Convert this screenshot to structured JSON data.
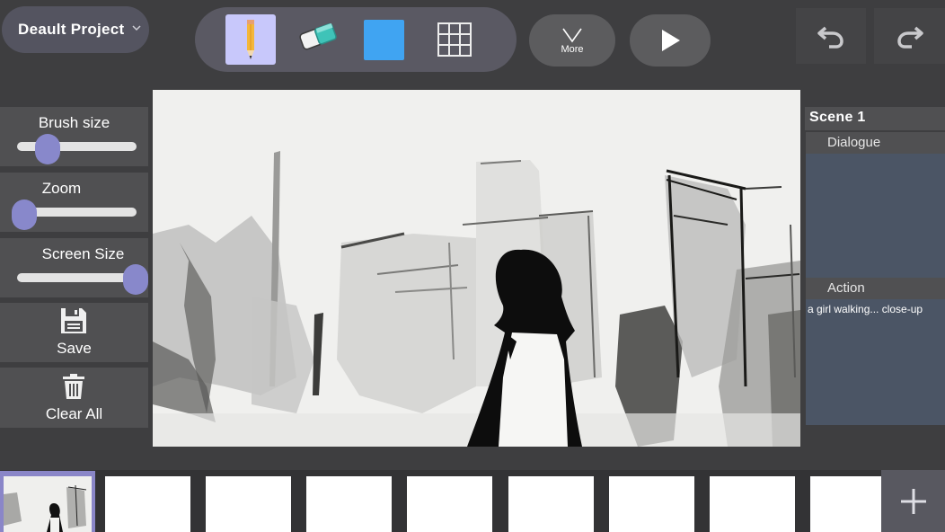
{
  "project": {
    "name": "Deault Project"
  },
  "toolbar": {
    "tools": [
      "pencil",
      "eraser",
      "color",
      "grid"
    ],
    "more_label": "More",
    "accent": "#c8c8fb",
    "color_swatch": "#40a4f2"
  },
  "left_panel": {
    "brush_size": {
      "label": "Brush size",
      "value": 0.22
    },
    "zoom": {
      "label": "Zoom",
      "value": 0.0
    },
    "screen_size": {
      "label": "Screen Size",
      "value": 1.0
    },
    "save_label": "Save",
    "clear_label": "Clear All"
  },
  "scene": {
    "title": "Scene 1",
    "dialogue_label": "Dialogue",
    "dialogue_text": "",
    "action_label": "Action",
    "action_text": "a girl walking... close-up"
  },
  "filmstrip": {
    "frames": 9,
    "selected": 0
  },
  "colors": {
    "background": "#3e3e40",
    "slider_knob": "#8888cb",
    "scene_area": "#4b5565"
  }
}
